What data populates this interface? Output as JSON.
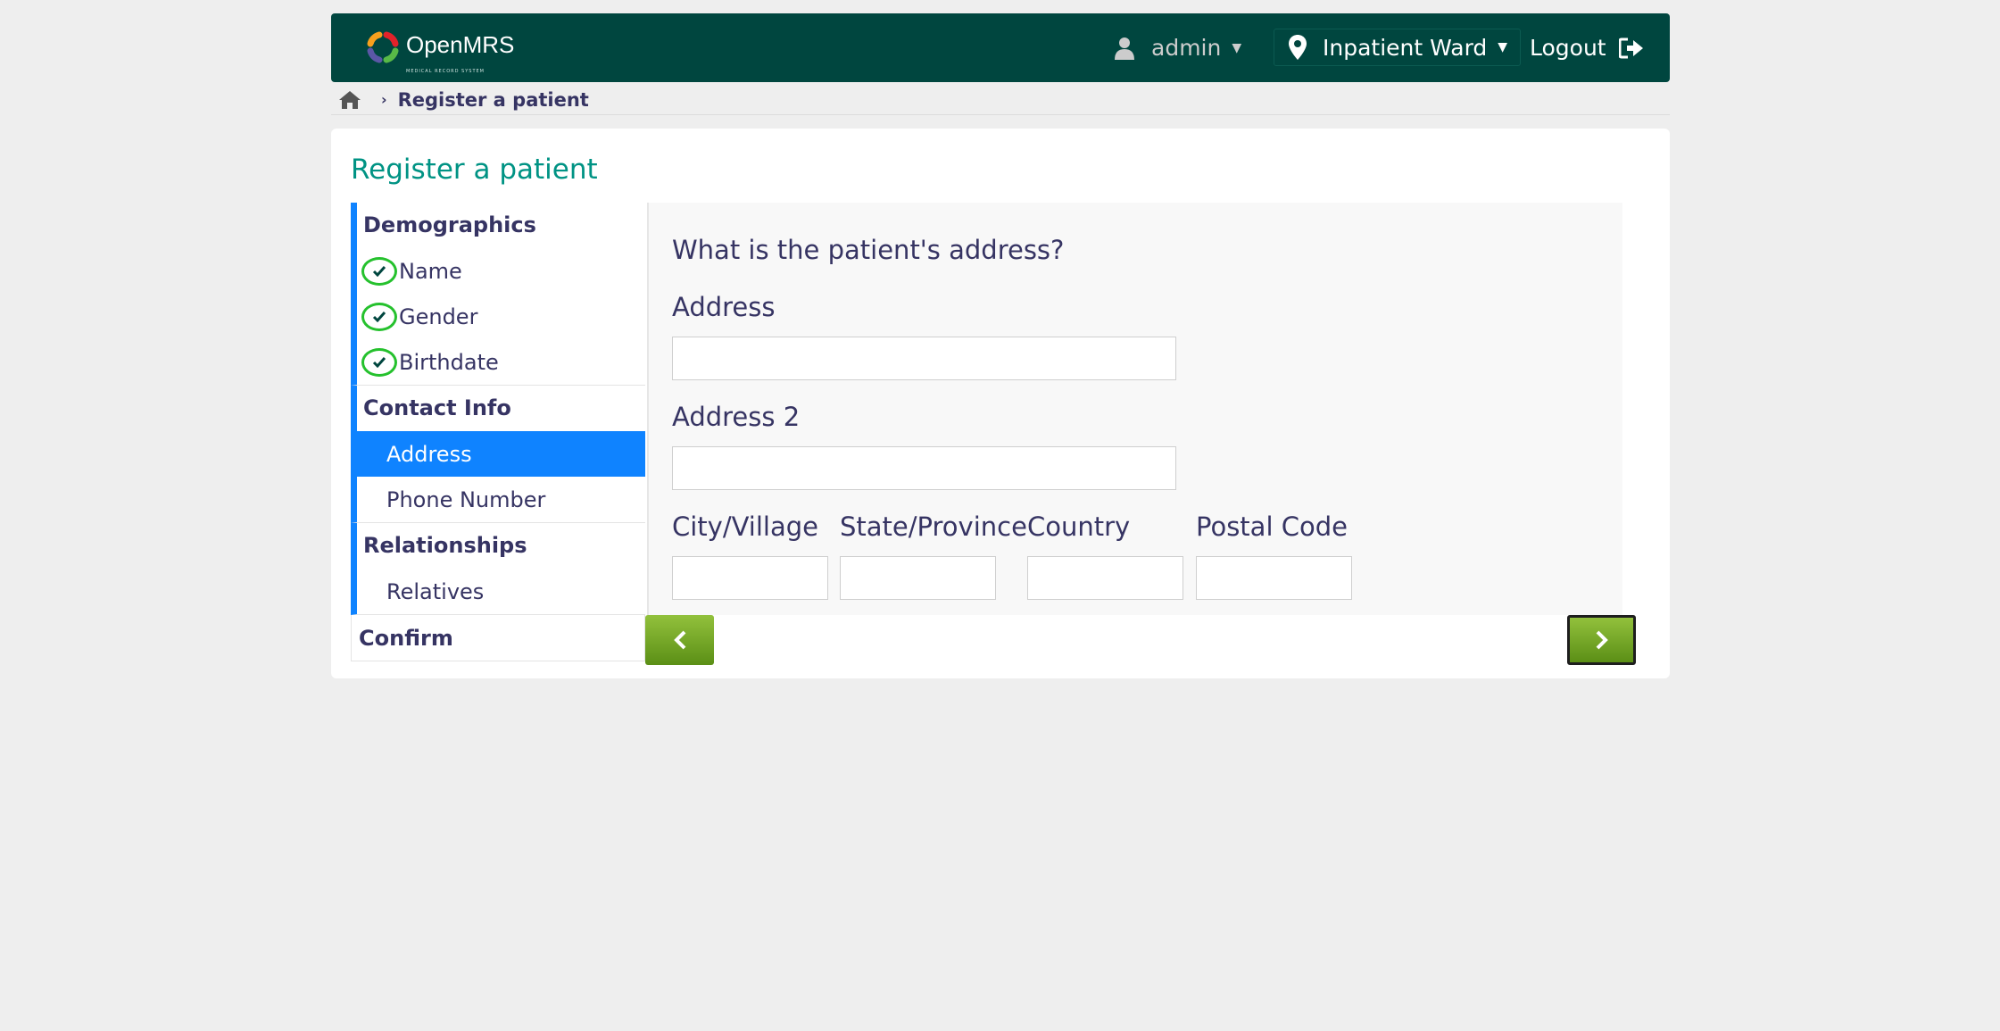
{
  "header": {
    "logo_text": "OpenMRS",
    "logo_subtitle": "MEDICAL RECORD SYSTEM",
    "user": "admin",
    "location": "Inpatient Ward",
    "logout": "Logout"
  },
  "breadcrumb": {
    "current": "Register a patient"
  },
  "page": {
    "title": "Register a patient"
  },
  "nav": {
    "demographics": {
      "label": "Demographics",
      "items": [
        {
          "label": "Name"
        },
        {
          "label": "Gender"
        },
        {
          "label": "Birthdate"
        }
      ]
    },
    "contact": {
      "label": "Contact Info",
      "items": [
        {
          "label": "Address"
        },
        {
          "label": "Phone Number"
        }
      ]
    },
    "relationships": {
      "label": "Relationships",
      "items": [
        {
          "label": "Relatives"
        }
      ]
    },
    "confirm": "Confirm"
  },
  "form": {
    "question": "What is the patient's address?",
    "address_label": "Address",
    "address_value": "",
    "address2_label": "Address 2",
    "address2_value": "",
    "city_label": "City/Village",
    "city_value": "",
    "state_label": "State/Province",
    "state_value": "",
    "country_label": "Country",
    "country_value": "",
    "postal_label": "Postal Code",
    "postal_value": ""
  },
  "colors": {
    "header_bg": "#00463f",
    "accent_blue": "#0f83ff",
    "title_green": "#009384",
    "check_green": "#25c12d",
    "button_green": "#7bab2a"
  }
}
